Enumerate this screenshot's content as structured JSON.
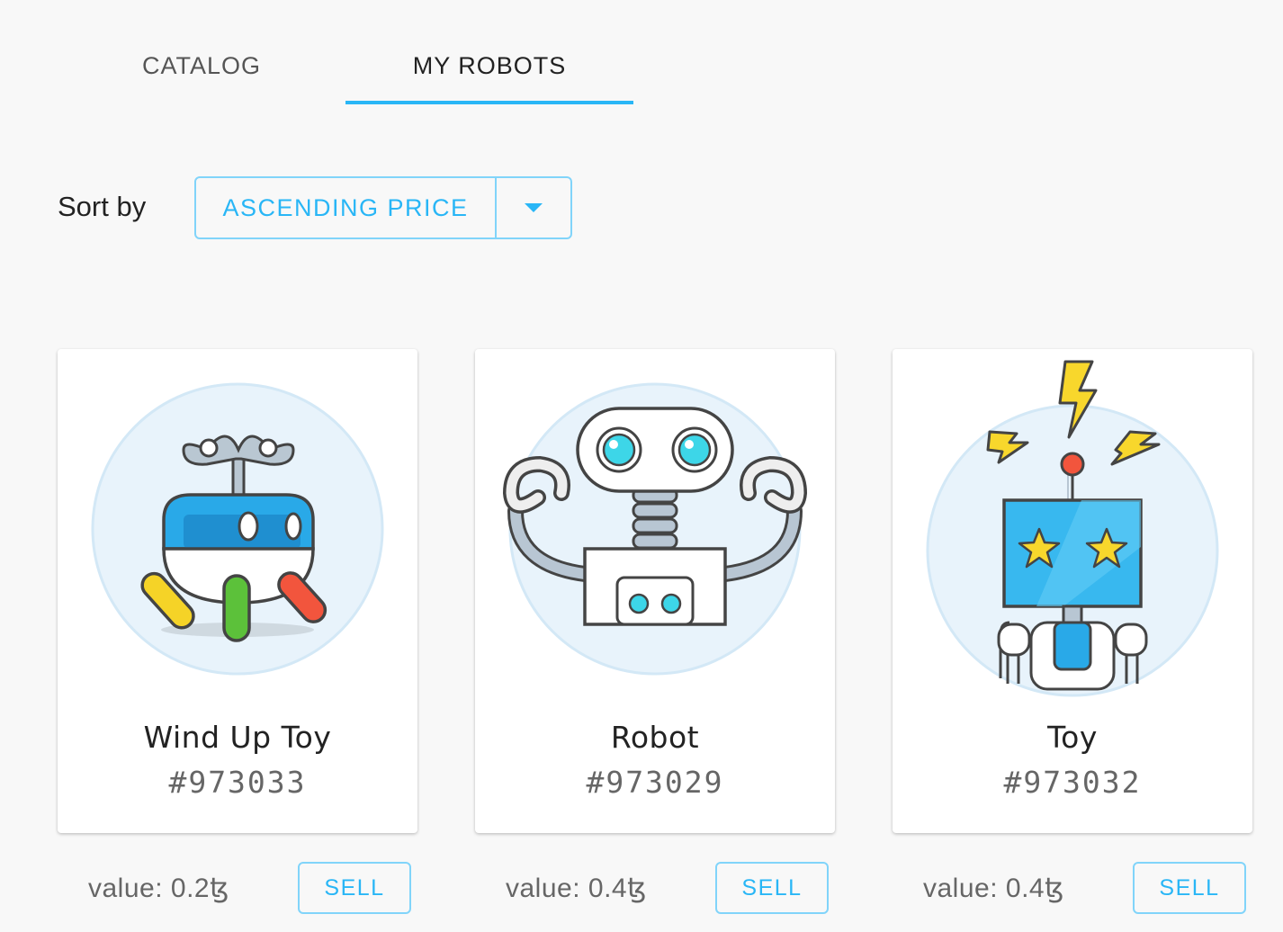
{
  "tabs": [
    {
      "label": "CATALOG",
      "active": false
    },
    {
      "label": "MY ROBOTS",
      "active": true
    }
  ],
  "sort": {
    "label": "Sort by",
    "selected": "ASCENDING PRICE"
  },
  "colors": {
    "accent": "#29b6f6",
    "accent_border": "#81d4fa",
    "background": "#f8f8f8"
  },
  "robots": [
    {
      "name": "Wind Up Toy",
      "id": "#973033",
      "value": "value: 0.2ꜩ",
      "action": "SELL",
      "icon": "wind-up-toy-robot-icon"
    },
    {
      "name": "Robot",
      "id": "#973029",
      "value": "value: 0.4ꜩ",
      "action": "SELL",
      "icon": "robot-icon"
    },
    {
      "name": "Toy",
      "id": "#973032",
      "value": "value: 0.4ꜩ",
      "action": "SELL",
      "icon": "toy-robot-icon"
    }
  ]
}
